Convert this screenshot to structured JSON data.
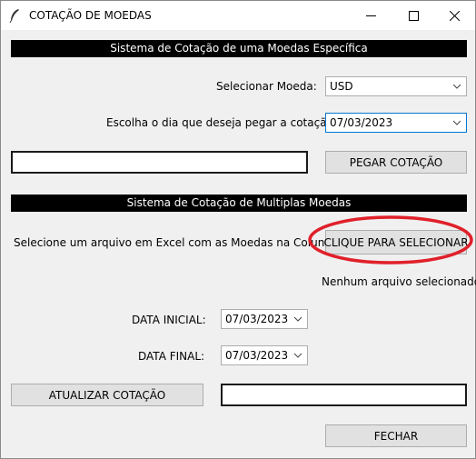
{
  "window": {
    "title": "COTAÇÃO DE MOEDAS",
    "app_icon": "feather-icon",
    "controls": {
      "minimize": "minimize-icon",
      "maximize": "maximize-icon",
      "close": "close-icon"
    }
  },
  "section1": {
    "banner": "Sistema de Cotação de uma Moedas Específica",
    "currency_label": "Selecionar Moeda:",
    "currency_value": "USD",
    "date_label": "Escolha o dia que deseja pegar a cotação:",
    "date_value": "07/03/2023",
    "result_value": "",
    "fetch_button": "PEGAR COTAÇÃO"
  },
  "section2": {
    "banner": "Sistema de Cotação de Multiplas Moedas",
    "file_label": "Selecione um arquivo em Excel com as Moedas na Coluna A:",
    "select_button": "CLIQUE PARA SELECIONAR",
    "file_status": "Nenhum arquivo selecionado",
    "start_date_label": "DATA INICIAL:",
    "start_date_value": "07/03/2023",
    "end_date_label": "DATA FINAL:",
    "end_date_value": "07/03/2023",
    "update_button": "ATUALIZAR COTAÇÃO",
    "update_status": "",
    "close_button": "FECHAR"
  },
  "colors": {
    "highlight_ellipse": "#e0202a",
    "focus_border": "#0078d7",
    "banner_bg": "#000000"
  }
}
